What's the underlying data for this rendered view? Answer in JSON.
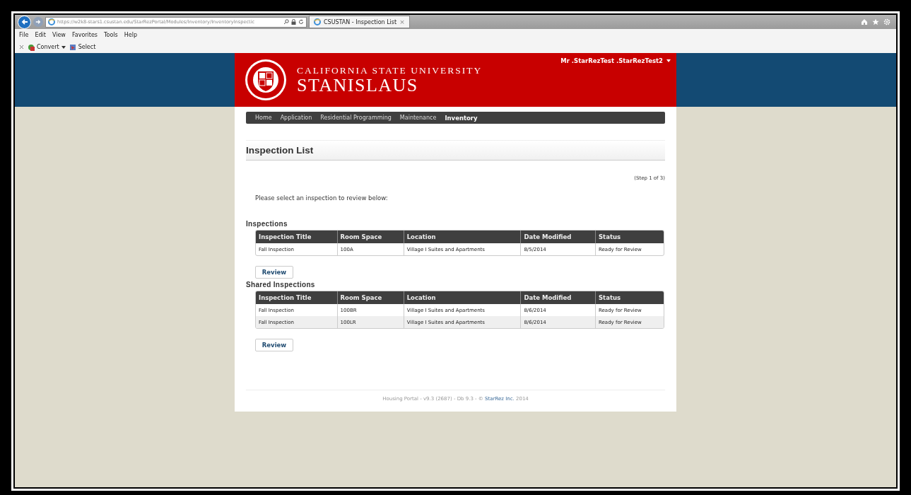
{
  "browser": {
    "address": "https://w2k8-stars1.csustan.edu/StarRezPortal/Modules/Inventory/InventoryInspectic",
    "tabs": [
      {
        "label": "CSUSTAN - Inspection List",
        "close": "×",
        "selected": true
      }
    ],
    "menu": [
      "File",
      "Edit",
      "View",
      "Favorites",
      "Tools",
      "Help"
    ],
    "toolbar": [
      {
        "kind": "dropdown",
        "label": "Convert"
      },
      {
        "kind": "button",
        "label": "Select"
      }
    ]
  },
  "header": {
    "line1": "CALIFORNIA STATE UNIVERSITY",
    "line2": "STANISLAUS",
    "user": "Mr .StarRezTest .StarRezTest2"
  },
  "nav": [
    {
      "label": "Home",
      "selected": false
    },
    {
      "label": "Application",
      "selected": false
    },
    {
      "label": "Residential Programming",
      "selected": false
    },
    {
      "label": "Maintenance",
      "selected": false
    },
    {
      "label": "Inventory",
      "selected": true
    }
  ],
  "page": {
    "title": "Inspection List",
    "step": "(Step 1 of 3)",
    "prompt": "Please select an inspection to review below:",
    "sections": [
      {
        "heading": "Inspections",
        "columns": [
          "Inspection Title",
          "Room Space",
          "Location",
          "Date Modified",
          "Status"
        ],
        "rows": [
          [
            "Fall Inspection",
            "100A",
            "Village I Suites and Apartments",
            "8/5/2014",
            "Ready for Review"
          ]
        ],
        "button": "Review"
      },
      {
        "heading": "Shared Inspections",
        "columns": [
          "Inspection Title",
          "Room Space",
          "Location",
          "Date Modified",
          "Status"
        ],
        "rows": [
          [
            "Fall Inspection",
            "100BR",
            "Village I Suites and Apartments",
            "8/6/2014",
            "Ready for Review"
          ],
          [
            "Fall Inspection",
            "100LR",
            "Village I Suites and Apartments",
            "8/6/2014",
            "Ready for Review"
          ]
        ],
        "button": "Review"
      }
    ]
  },
  "footer": {
    "before": "Housing Portal - v9.3 (2687) - Db 9.3 - ©",
    "link": "StarRez Inc.",
    "after": "2014"
  }
}
